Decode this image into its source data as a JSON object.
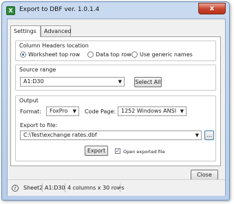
{
  "window": {
    "app_icon": "excel-x-icon",
    "title": "Export to DBF  ver. 1.0.1.4",
    "close_glyph": "x"
  },
  "tabs": [
    {
      "label": "Settings",
      "active": true
    },
    {
      "label": "Advanced",
      "active": false
    }
  ],
  "column_headers": {
    "label": "Column Headers location",
    "options": [
      {
        "label": "Worksheet top row",
        "checked": true
      },
      {
        "label": "Data top row",
        "checked": false
      },
      {
        "label": "Use generic names",
        "checked": false
      }
    ]
  },
  "source_range": {
    "label": "Source range",
    "value": "A1:D30",
    "select_all_label": "Select All"
  },
  "output": {
    "label": "Output",
    "format_label": "Format:",
    "format_value": "FoxPro",
    "code_page_label": "Code Page:",
    "code_page_value": "1252 Windows ANSI",
    "export_to_file_label": "Export to file:",
    "file_path": "C:\\Test\\exchange rates.dbf",
    "browse_label": "...",
    "export_label": "Export",
    "open_exported_label": "Open exported file",
    "open_exported_checked": true
  },
  "close_label": "Close",
  "status": {
    "sheet": "Sheet2",
    "range": "A1:D30",
    "size": "4 columns x 30 rows"
  }
}
